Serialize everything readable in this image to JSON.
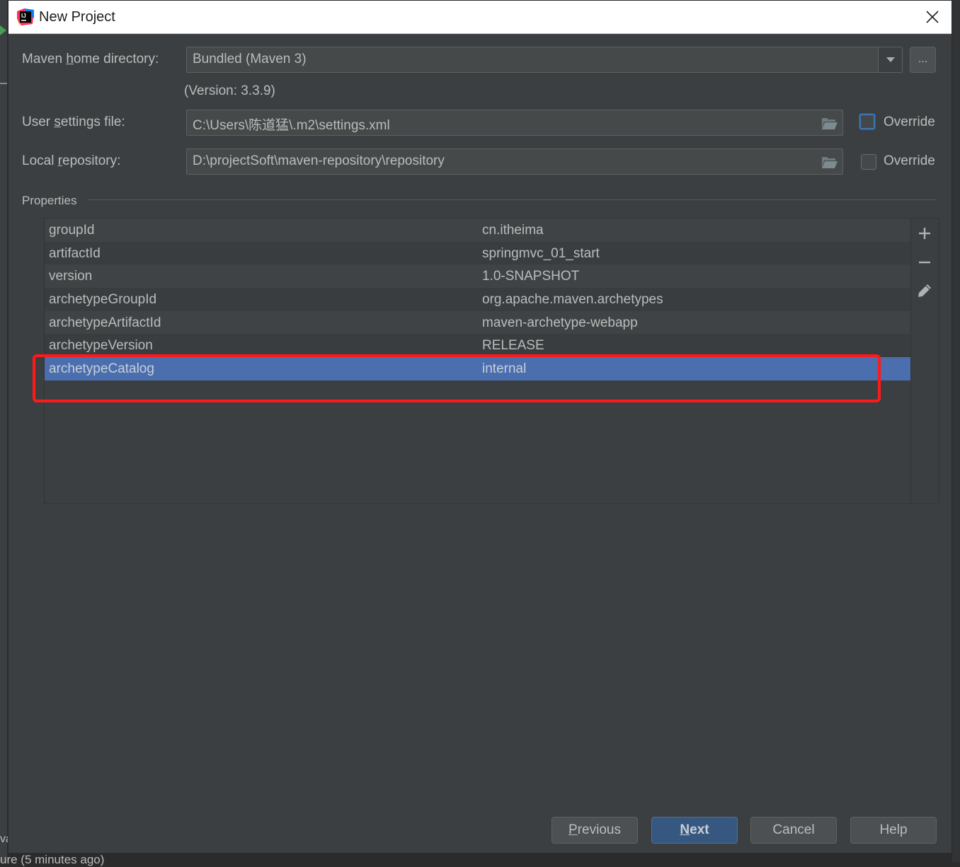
{
  "background": {
    "left_fragment_text": "va",
    "status_text": "ure (5 minutes ago)"
  },
  "dialog": {
    "title": "New Project",
    "app_icon": "intellij-idea-icon"
  },
  "maven": {
    "home_label_pre": "Maven ",
    "home_label_mnemonic": "h",
    "home_label_post": "ome directory:",
    "home_value": "Bundled (Maven 3)",
    "browse_label": "...",
    "version_text": "(Version: 3.3.9)",
    "settings_label_pre": "User ",
    "settings_label_mnemonic": "s",
    "settings_label_post": "ettings file:",
    "settings_value": "C:\\Users\\陈道猛\\.m2\\settings.xml",
    "settings_override_label": "Override",
    "settings_override_checked": false,
    "repo_label_pre": "Local ",
    "repo_label_mnemonic": "r",
    "repo_label_post": "epository:",
    "repo_value": "D:\\projectSoft\\maven-repository\\repository",
    "repo_override_label": "Override",
    "repo_override_checked": false
  },
  "properties": {
    "section_title": "Properties",
    "rows": [
      {
        "key": "groupId",
        "value": "cn.itheima"
      },
      {
        "key": "artifactId",
        "value": "springmvc_01_start"
      },
      {
        "key": "version",
        "value": "1.0-SNAPSHOT"
      },
      {
        "key": "archetypeGroupId",
        "value": "org.apache.maven.archetypes"
      },
      {
        "key": "archetypeArtifactId",
        "value": "maven-archetype-webapp"
      },
      {
        "key": "archetypeVersion",
        "value": "RELEASE"
      },
      {
        "key": "archetypeCatalog",
        "value": "internal"
      }
    ],
    "selected_row": 6,
    "toolbar": [
      "add-icon",
      "remove-icon",
      "edit-icon"
    ]
  },
  "colors": {
    "selection": "#4b6eaf",
    "highlight_annotation": "#ff1a1a",
    "primary_button": "#365880"
  },
  "buttons": {
    "previous_mnemonic": "P",
    "previous_rest": "revious",
    "next_mnemonic": "N",
    "next_rest": "ext",
    "cancel": "Cancel",
    "help": "Help"
  }
}
